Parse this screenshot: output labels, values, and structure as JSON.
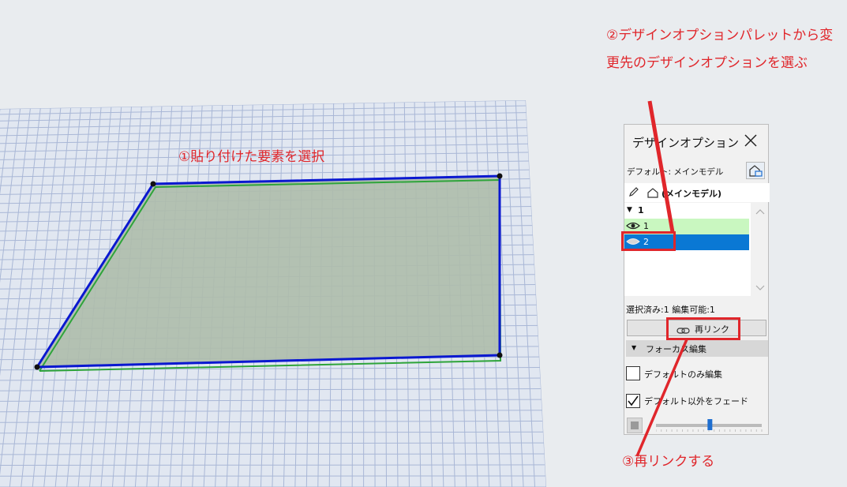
{
  "callouts": {
    "select_elements": "①貼り付けた要素を選択",
    "choose_option": "②デザインオプションパレットから変更先のデザインオプションを選ぶ",
    "relink": "③再リンクする"
  },
  "palette": {
    "title": "デザインオプション",
    "default_label": "デフォルト: メインモデル",
    "main_model_label": "(メインモデル)",
    "tree": {
      "group_label": "1",
      "items": [
        {
          "label": "1",
          "visible": true,
          "selected": false
        },
        {
          "label": "2",
          "visible": false,
          "selected": true
        }
      ]
    },
    "status": "選択済み:1 編集可能:1",
    "relink_label": "再リンク",
    "focus_edit_label": "フォーカス編集",
    "checkbox_default_only": {
      "label": "デフォルトのみ編集",
      "checked": false
    },
    "checkbox_fade": {
      "label": "デフォルト以外をフェード",
      "checked": true
    },
    "fade_level": 0.51
  },
  "colors": {
    "annotation": "#e0262b",
    "selection_outline": "#0a18d0",
    "selected_row": "#0a78d4",
    "visible_row": "#c9f7c0",
    "slab_fill": "#aebdab",
    "grid_line": "#a9b7d6"
  }
}
